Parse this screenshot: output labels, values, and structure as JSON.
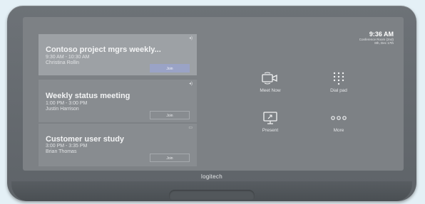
{
  "clock": {
    "time": "9:36 AM",
    "room": "Conference Room (2nd)",
    "date": "8th, Dec 17th"
  },
  "meetings": [
    {
      "title": "Contoso project mgrs weekly...",
      "time": "9:30 AM - 10:30 AM",
      "organizer": "Christina Rollin",
      "join_label": "Join",
      "active": true
    },
    {
      "title": "Weekly status meeting",
      "time": "1:00 PM - 3:00 PM",
      "organizer": "Justin Harrison",
      "join_label": "Join",
      "active": false
    },
    {
      "title": "Customer user study",
      "time": "3:00 PM - 3:35 PM",
      "organizer": "Brian Thomas",
      "join_label": "Join",
      "active": false
    }
  ],
  "actions": [
    {
      "label": "Meet Now",
      "icon": "video-camera-icon"
    },
    {
      "label": "Dial pad",
      "icon": "dialpad-icon"
    },
    {
      "label": "Present",
      "icon": "present-screen-icon"
    },
    {
      "label": "More",
      "icon": "more-dots-icon"
    }
  ],
  "brand": "logitech"
}
